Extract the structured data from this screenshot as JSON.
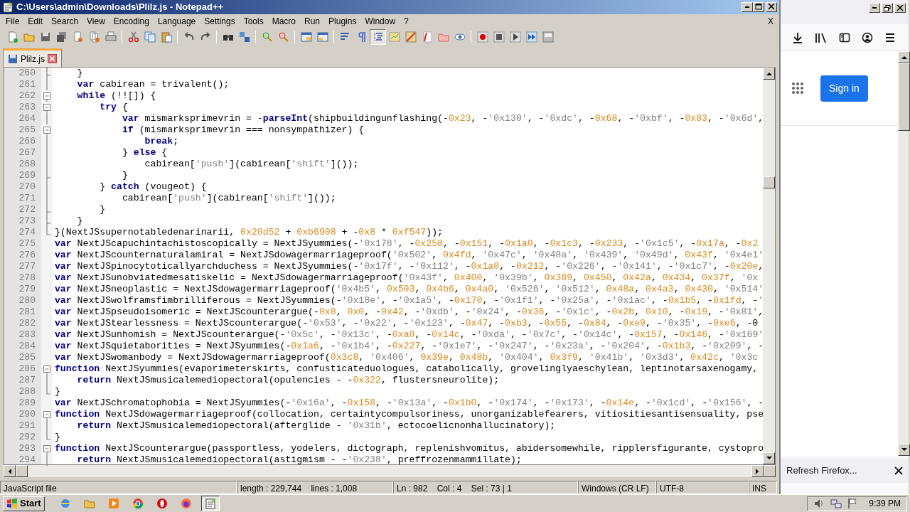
{
  "window": {
    "title": "C:\\Users\\admin\\Downloads\\Plilz.js - Notepad++"
  },
  "menu": [
    "File",
    "Edit",
    "Search",
    "View",
    "Encoding",
    "Language",
    "Settings",
    "Tools",
    "Macro",
    "Run",
    "Plugins",
    "Window",
    "?"
  ],
  "menu_close": "X",
  "toolbar": [
    {
      "pressed": false
    },
    {
      "pressed": false
    },
    {
      "pressed": false
    },
    {
      "pressed": false
    },
    {
      "pressed": false
    },
    {
      "pressed": false
    },
    {
      "pressed": false
    },
    {
      "pressed": false
    },
    {
      "pressed": false
    },
    {
      "pressed": false
    },
    {
      "pressed": false
    },
    {
      "pressed": false
    },
    {
      "pressed": false
    },
    {
      "pressed": false
    },
    {
      "pressed": false
    },
    {
      "pressed": false
    },
    {
      "pressed": false
    },
    {
      "pressed": false
    },
    {
      "pressed": false
    },
    {
      "pressed": false
    },
    {
      "pressed": true
    },
    {
      "pressed": false
    },
    {
      "pressed": false
    },
    {
      "pressed": false
    },
    {
      "pressed": false
    },
    {
      "pressed": false
    },
    {
      "pressed": false
    },
    {
      "pressed": false
    },
    {
      "pressed": false
    },
    {
      "pressed": false
    },
    {
      "pressed": false
    }
  ],
  "tabs": [
    {
      "label": "Plilz.js",
      "selected": true
    }
  ],
  "lines": [
    {
      "number": "260",
      "kind": "tick",
      "text": "    }"
    },
    {
      "number": "261",
      "kind": "line",
      "text": "    **var** cabirean = trivalent();"
    },
    {
      "number": "262",
      "kind": "open",
      "text": "    **while** (!![]) {"
    },
    {
      "number": "263",
      "kind": "open",
      "text": "        **try** {"
    },
    {
      "number": "264",
      "kind": "line",
      "text": "            **var** mismarksprimevrin = -**parseInt**(shipbuildingunflashing(-0x23, -'0x130', -'0xdc', -0x68, -'0xbf', -0x83, -'0x6d',"
    },
    {
      "number": "265",
      "kind": "open",
      "text": "            **if** (mismarksprimevrin === nonsympathizer) {"
    },
    {
      "number": "266",
      "kind": "line",
      "text": "                **break**;"
    },
    {
      "number": "267",
      "kind": "line",
      "text": "            } **else** {"
    },
    {
      "number": "268",
      "kind": "line",
      "text": "                cabirean['push'](cabirean['shift']());"
    },
    {
      "number": "269",
      "kind": "tick",
      "text": "            }"
    },
    {
      "number": "270",
      "kind": "line",
      "text": "        } **catch** (vougeot) {"
    },
    {
      "number": "271",
      "kind": "line",
      "text": "            cabirean['push'](cabirean['shift']());"
    },
    {
      "number": "272",
      "kind": "tick",
      "text": "        }"
    },
    {
      "number": "273",
      "kind": "tick",
      "text": "    }"
    },
    {
      "number": "274",
      "kind": "close",
      "text": "}(NextJSsupernotabledenarinarii, 0x20d52 + 0xb6908 + -0x8 * 0xf547));"
    },
    {
      "number": "275",
      "text": "**var** NextJScapuchintachistoscopically = NextJSyummies(-'0x178', -0x258, -0x151, -0x1a0, -0x1c3, -0x233, -'0x1c5', -0x17a, -0x2"
    },
    {
      "number": "276",
      "text": "**var** NextJScounternaturalamiral = NextJSdowagermarriageproof('0x502', 0x4fd, '0x47c', '0x48a', '0x439', '0x49d', 0x43f, '0x4e1'"
    },
    {
      "number": "277",
      "text": "**var** NextJSpinocytoticallyarchduchess = NextJSyummies(-'0x17f', -'0x112', -0x1a0, -0x212, -'0x226', -'0x141', -'0x1c7', -0x20e,"
    },
    {
      "number": "278",
      "text": "**var** NextJSunobviatedmesatiskelic = NextJSdowagermarriageproof('0x43f', 0x400, '0x39b', 0x389, 0x450, 0x42a, 0x434, 0x37f, '0x"
    },
    {
      "number": "279",
      "text": "**var** NextJSneoplastic = NextJSdowagermarriageproof('0x4b5', 0x503, 0x4b6, 0x4a0, '0x526', '0x512', 0x48a, 0x4a3, 0x430, '0x514'"
    },
    {
      "number": "280",
      "text": "**var** NextJSwolframsfimbrilliferous = NextJSyummies(-'0x18e', -'0x1a5', -0x170, -'0x1f1', -'0x25a', -'0x1ac', -0x1b5, -0x1fd, -'"
    },
    {
      "number": "281",
      "text": "**var** NextJSpseudoisomeric = NextJScounterargue(-0x8, 0x0, -0x42, -'0xdb', -'0x24', -0x36, -'0x1c', -0x2b, 0x10, -0x19, -'0x81',"
    },
    {
      "number": "282",
      "text": "**var** NextJStearlessness = NextJScounterargue(-'0x53', -'0x22', -'0x123', -0x47, -0xb3, -0x55, -0x84, -0xe9, -'0x35', -0xe6, -0"
    },
    {
      "number": "283",
      "text": "**var** NextJSunhomish = NextJScounterargue(-'0x5c', -'0x13c', -0xa0, -0x14c, -'0xda', -'0x7c', -'0x14c', -0x157, -0x146, -'0x169'"
    },
    {
      "number": "284",
      "text": "**var** NextJSquietaborities = NextJSyummies(-0x1a6, -'0x1b4', -0x227, -'0x1e7', -'0x247', -'0x23a', -'0x204', -0x1b3, -'0x209', -"
    },
    {
      "number": "285",
      "text": "**var** NextJSwomanbody = NextJSdowagermarriageproof(0x3c8, '0x406', 0x39e, 0x48b, '0x404', 0x3f9, '0x41b', '0x3d3', 0x42c, '0x3c"
    },
    {
      "number": "286",
      "kind": "open",
      "text": "**function** NextJSyummies(evaporimeterskirts, confusticateduologues, catabolically, grovelinglyaeschylean, leptinotarsaxenogamy,"
    },
    {
      "number": "287",
      "kind": "line",
      "text": "    **return** NextJSmusicalemediopectoral(opulencies - -0x322, flustersneurolite);"
    },
    {
      "number": "288",
      "kind": "close",
      "text": "}"
    },
    {
      "number": "289",
      "text": "**var** NextJSchromatophobia = NextJSyummies(-'0x16a', -0x158, -'0x13a', -0x1b0, -'0x174', -'0x173', -0x14e, -'0x1cd', -'0x156', -"
    },
    {
      "number": "290",
      "kind": "open",
      "text": "**function** NextJSdowagermarriageproof(collocation, certaintycompulsoriness, unorganizablefearers, vitiositiesantisensuality, pse"
    },
    {
      "number": "291",
      "kind": "line",
      "text": "    **return** NextJSmusicalemediopectoral(afterglide - '0x31b', ectocoelicnonhallucinatory);"
    },
    {
      "number": "292",
      "kind": "close",
      "text": "}"
    },
    {
      "number": "293",
      "kind": "open",
      "text": "**function** NextJScounterargue(passportless, yodelers, dictograph, replenishvomitus, abidersomewhile, ripplersfigurante, cystopro"
    },
    {
      "number": "294",
      "kind": "line",
      "text": "    **return** NextJSmusicalemediopectoral(astigmism - -'0x238', preffrozenmammillate);"
    }
  ],
  "status_bar": [
    "JavaScript file",
    "length : 229,744    lines : 1,008",
    "Ln : 982    Col : 4    Sel : 73 | 1",
    "Windows (CR LF)",
    "UTF-8",
    "INS"
  ],
  "browser": {
    "sign_in": "Sign in",
    "notification": "Refresh Firefox..."
  },
  "taskbar": {
    "start": "Start",
    "apps": [
      {
        "selected": false
      },
      {
        "selected": false
      },
      {
        "selected": false
      },
      {
        "selected": false
      },
      {
        "selected": false
      },
      {
        "selected": false
      },
      {
        "selected": true
      }
    ],
    "clock": "9:39 PM"
  }
}
